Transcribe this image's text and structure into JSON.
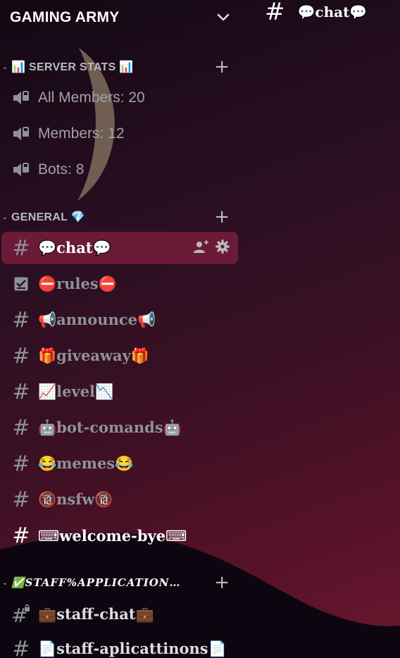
{
  "server": {
    "name": "GAMING ARMY"
  },
  "topbar": {
    "channel_title": "💬chat💬"
  },
  "categories": [
    {
      "label": "📊 SERVER STATS 📊"
    },
    {
      "label": "GENERAL 💎"
    },
    {
      "label": "✅STAFF%APPLICATION…"
    }
  ],
  "voice_channels": [
    {
      "label": "All Members: 20"
    },
    {
      "label": "Members: 12"
    },
    {
      "label": "Bots: 8"
    }
  ],
  "text_channels": [
    {
      "label": "💬chat💬",
      "active": true
    },
    {
      "label": "⛔rules⛔"
    },
    {
      "label": "📢announce📢"
    },
    {
      "label": "🎁giveaway🎁"
    },
    {
      "label": "📈level📉"
    },
    {
      "label": "🤖bot-comands🤖"
    },
    {
      "label": "😂memes😂"
    },
    {
      "label": "🔞nsfw🔞"
    },
    {
      "label": "⌨welcome-bye⌨"
    }
  ],
  "staff_channels": [
    {
      "label": "💼staff-chat💼"
    },
    {
      "label": "📄staff-aplicattinons📄"
    }
  ],
  "colors": {
    "active_bg": "#6b1a37",
    "muted_text": "#8e9297",
    "header_text": "#ffffff"
  },
  "icons": {
    "header_chevron": "chevron-down-icon",
    "add": "plus-icon",
    "voice": "speaker-lock-icon",
    "text": "hash-icon",
    "rules": "checkbox-icon",
    "locked_text": "hash-lock-icon",
    "invite": "add-member-icon",
    "settings": "gear-icon"
  }
}
